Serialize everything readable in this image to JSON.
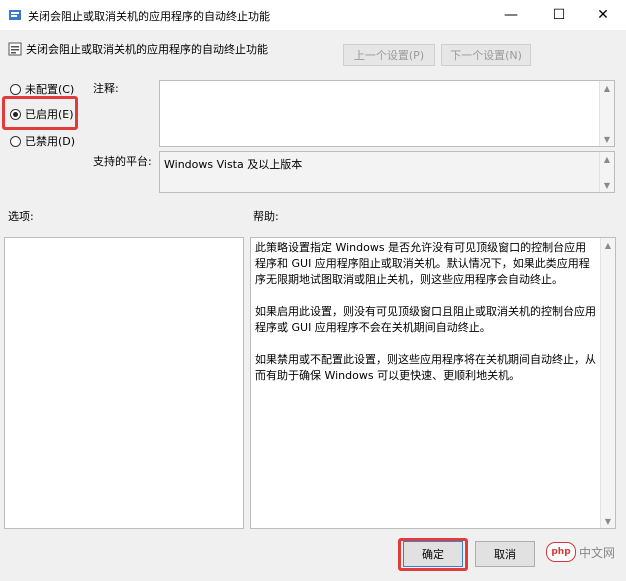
{
  "window": {
    "title": "关闭会阻止或取消关机的应用程序的自动终止功能",
    "controls": {
      "minimize": "—",
      "maximize": "☐",
      "close": "✕"
    }
  },
  "header": {
    "policy_name": "关闭会阻止或取消关机的应用程序的自动终止功能",
    "prev_setting": "上一个设置(P)",
    "next_setting": "下一个设置(N)"
  },
  "state": {
    "options": [
      {
        "label": "未配置(C)",
        "checked": false
      },
      {
        "label": "已启用(E)",
        "checked": true
      },
      {
        "label": "已禁用(D)",
        "checked": false
      }
    ]
  },
  "comment": {
    "label": "注释:",
    "value": ""
  },
  "platform": {
    "label": "支持的平台:",
    "value": "Windows Vista 及以上版本"
  },
  "options_section": {
    "label": "选项:"
  },
  "help_section": {
    "label": "帮助:",
    "paragraphs": [
      "此策略设置指定 Windows 是否允许没有可见顶级窗口的控制台应用程序和 GUI 应用程序阻止或取消关机。默认情况下，如果此类应用程序无限期地试图取消或阻止关机，则这些应用程序会自动终止。",
      "如果启用此设置，则没有可见顶级窗口且阻止或取消关机的控制台应用程序或 GUI 应用程序不会在关机期间自动终止。",
      "如果禁用或不配置此设置，则这些应用程序将在关机期间自动终止，从而有助于确保 Windows 可以更快速、更顺利地关机。"
    ]
  },
  "footer": {
    "ok": "确定",
    "cancel": "取消"
  },
  "watermark": {
    "badge": "php",
    "text": "中文网"
  },
  "colors": {
    "highlight": "#e23b3b",
    "background": "#f0f0f0"
  }
}
